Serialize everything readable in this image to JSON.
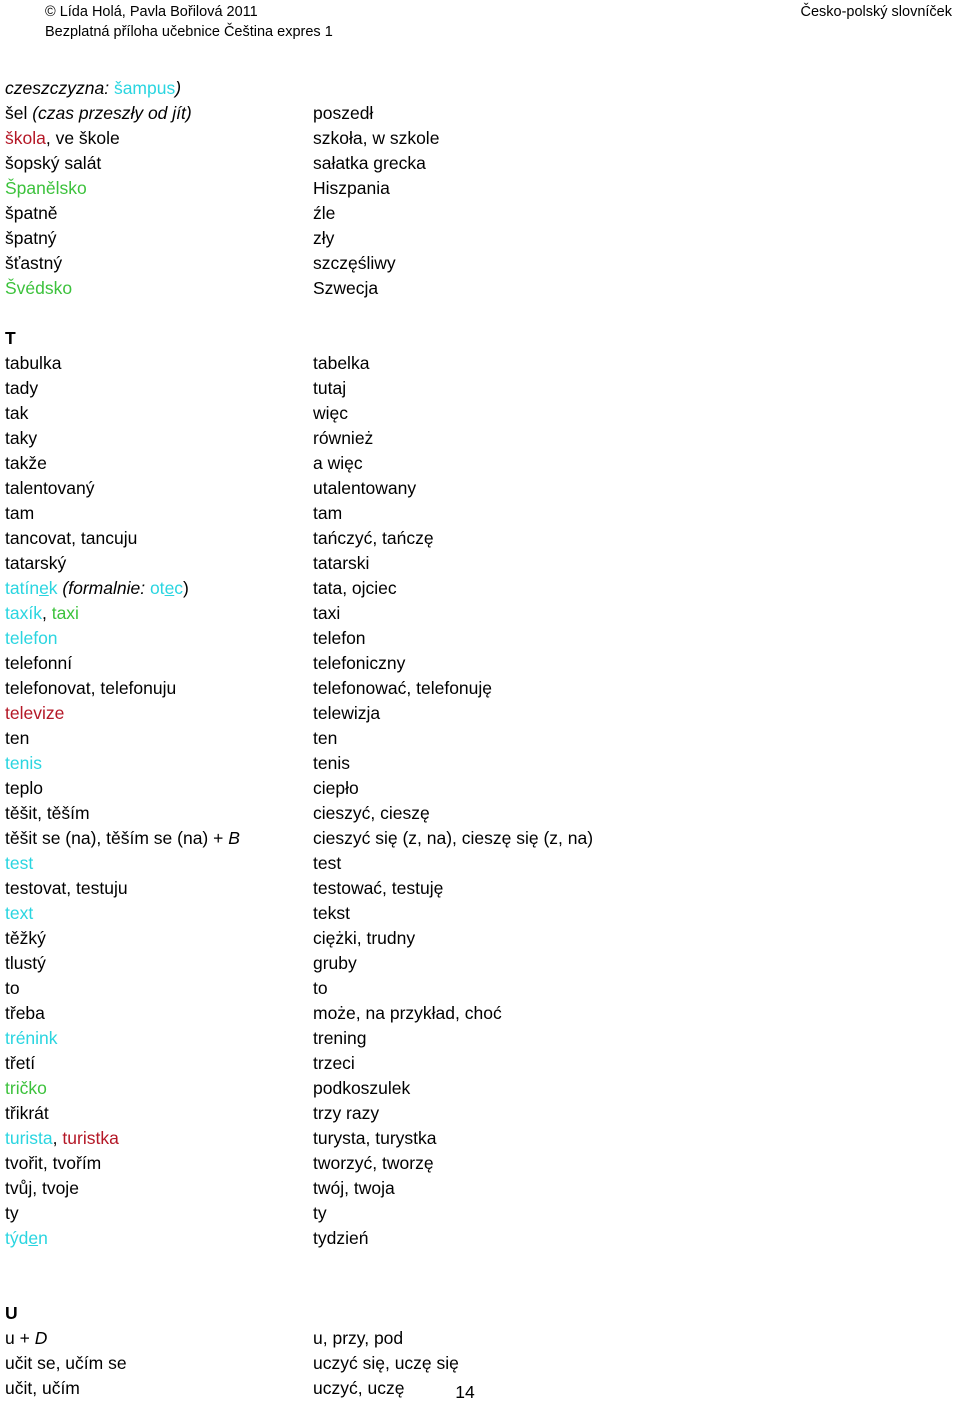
{
  "header": {
    "copyright": "© Lída Holá, Pavla Bořilová 2011",
    "subtitle": "Bezplatná příloha učebnice Čeština expres 1",
    "title": "Česko-polský slovníček"
  },
  "colors": {
    "cyan": "#2ad5e0",
    "green": "#3cc23c",
    "red": "#b41726",
    "black": "#000000"
  },
  "page_number": "14",
  "entries": [
    {
      "type": "entry",
      "cz": "czeszczyzna: šampus)",
      "pl": ""
    },
    {
      "type": "entry",
      "cz": "šel (czas przeszły od  jít)",
      "pl": "poszedł"
    },
    {
      "type": "entry",
      "cz": "škola, ve škole",
      "pl": "szkoła, w szkole"
    },
    {
      "type": "entry",
      "cz": "šopský salát",
      "pl": "sałatka grecka"
    },
    {
      "type": "entry",
      "cz": "Španělsko",
      "pl": "Hiszpania"
    },
    {
      "type": "entry",
      "cz": "špatně",
      "pl": "źle"
    },
    {
      "type": "entry",
      "cz": "špatný",
      "pl": "zły"
    },
    {
      "type": "entry",
      "cz": "šťastný",
      "pl": "szczęśliwy"
    },
    {
      "type": "entry",
      "cz": "Švédsko",
      "pl": "Szwecja"
    },
    {
      "type": "gap"
    },
    {
      "type": "letter",
      "cz": "T",
      "pl": ""
    },
    {
      "type": "entry",
      "cz": "tabulka",
      "pl": "tabelka"
    },
    {
      "type": "entry",
      "cz": "tady",
      "pl": "tutaj"
    },
    {
      "type": "entry",
      "cz": "tak",
      "pl": "więc"
    },
    {
      "type": "entry",
      "cz": "taky",
      "pl": "również"
    },
    {
      "type": "entry",
      "cz": "takže",
      "pl": "a więc"
    },
    {
      "type": "entry",
      "cz": "talentovaný",
      "pl": "utalentowany"
    },
    {
      "type": "entry",
      "cz": "tam",
      "pl": "tam"
    },
    {
      "type": "entry",
      "cz": "tancovat, tancuju",
      "pl": "tańczyć, tańczę"
    },
    {
      "type": "entry",
      "cz": "tatarský",
      "pl": "tatarski"
    },
    {
      "type": "entry",
      "cz": "tatínek (formalnie: otec)",
      "pl": "tata, ojciec"
    },
    {
      "type": "entry",
      "cz": "taxík, taxi",
      "pl": "taxi"
    },
    {
      "type": "entry",
      "cz": "telefon",
      "pl": "telefon"
    },
    {
      "type": "entry",
      "cz": "telefonní",
      "pl": "telefoniczny"
    },
    {
      "type": "entry",
      "cz": "telefonovat, telefonuju",
      "pl": "telefonować, telefonuję"
    },
    {
      "type": "entry",
      "cz": "televize",
      "pl": "telewizja"
    },
    {
      "type": "entry",
      "cz": "ten",
      "pl": "ten"
    },
    {
      "type": "entry",
      "cz": "tenis",
      "pl": "tenis"
    },
    {
      "type": "entry",
      "cz": "teplo",
      "pl": "ciepło"
    },
    {
      "type": "entry",
      "cz": "těšit, těším",
      "pl": "cieszyć, cieszę"
    },
    {
      "type": "entry",
      "cz": "těšit se (na), těším se (na) + B",
      "pl": "cieszyć się (z, na), cieszę się (z, na)"
    },
    {
      "type": "entry",
      "cz": "test",
      "pl": "test"
    },
    {
      "type": "entry",
      "cz": "testovat, testuju",
      "pl": "testować, testuję"
    },
    {
      "type": "entry",
      "cz": "text",
      "pl": "tekst"
    },
    {
      "type": "entry",
      "cz": "těžký",
      "pl": "ciężki, trudny"
    },
    {
      "type": "entry",
      "cz": "tlustý",
      "pl": "gruby"
    },
    {
      "type": "entry",
      "cz": "to",
      "pl": "to"
    },
    {
      "type": "entry",
      "cz": "třeba",
      "pl": "może, na przykład, choć"
    },
    {
      "type": "entry",
      "cz": "trénink",
      "pl": "trening"
    },
    {
      "type": "entry",
      "cz": "třetí",
      "pl": "trzeci"
    },
    {
      "type": "entry",
      "cz": "tričko",
      "pl": "podkoszulek"
    },
    {
      "type": "entry",
      "cz": "třikrát",
      "pl": "trzy razy"
    },
    {
      "type": "entry",
      "cz": "turista, turistka",
      "pl": "turysta, turystka"
    },
    {
      "type": "entry",
      "cz": "tvořit, tvořím",
      "pl": "tworzyć, tworzę"
    },
    {
      "type": "entry",
      "cz": "tvůj, tvoje",
      "pl": "twój, twoja"
    },
    {
      "type": "entry",
      "cz": "ty",
      "pl": "ty"
    },
    {
      "type": "entry",
      "cz": "týden",
      "pl": "tydzień"
    },
    {
      "type": "gap"
    },
    {
      "type": "gap"
    },
    {
      "type": "letter",
      "cz": "U",
      "pl": ""
    },
    {
      "type": "entry",
      "cz": "u + D",
      "pl": "u, przy, pod"
    },
    {
      "type": "entry",
      "cz": "učit se, učím se",
      "pl": "uczyć się, uczę się"
    },
    {
      "type": "entry",
      "cz": "učit, učím",
      "pl": "uczyć, uczę"
    }
  ],
  "cz_rich": {
    "0": [
      {
        "t": "czeszczyzna: ",
        "c": "black",
        "i": true
      },
      {
        "t": "šampus",
        "c": "cyan",
        "i": false
      },
      {
        "t": ")",
        "c": "black",
        "i": true
      }
    ],
    "1": [
      {
        "t": "šel ",
        "c": "black",
        "i": false
      },
      {
        "t": "(czas przeszły od  jít)",
        "c": "black",
        "i": true
      }
    ],
    "2": [
      {
        "t": "škola",
        "c": "red",
        "i": false
      },
      {
        "t": ", ve škole",
        "c": "black",
        "i": false
      }
    ],
    "3": [
      {
        "t": "šopský salát",
        "c": "black",
        "i": false
      }
    ],
    "4": [
      {
        "t": "Španělsko",
        "c": "green",
        "i": false
      }
    ],
    "5": [
      {
        "t": "špatně",
        "c": "black",
        "i": false
      }
    ],
    "6": [
      {
        "t": "špatný",
        "c": "black",
        "i": false
      }
    ],
    "7": [
      {
        "t": "šťastný",
        "c": "black",
        "i": false
      }
    ],
    "8": [
      {
        "t": "Švédsko",
        "c": "green",
        "i": false
      }
    ],
    "20": [
      {
        "t": "tatín",
        "c": "cyan",
        "i": false
      },
      {
        "t": "e",
        "c": "cyan",
        "i": false,
        "u": true
      },
      {
        "t": "k ",
        "c": "cyan",
        "i": false
      },
      {
        "t": "(formalnie: ",
        "c": "black",
        "i": true
      },
      {
        "t": "ot",
        "c": "cyan",
        "i": false
      },
      {
        "t": "e",
        "c": "cyan",
        "i": false,
        "u": true
      },
      {
        "t": "c",
        "c": "cyan",
        "i": false
      },
      {
        "t": ")",
        "c": "black",
        "i": false
      }
    ],
    "21": [
      {
        "t": "taxík",
        "c": "cyan",
        "i": false
      },
      {
        "t": ", ",
        "c": "black",
        "i": false
      },
      {
        "t": "taxi",
        "c": "green",
        "i": false
      }
    ],
    "22": [
      {
        "t": "telefon",
        "c": "cyan",
        "i": false
      }
    ],
    "25": [
      {
        "t": "televize",
        "c": "red",
        "i": false
      }
    ],
    "27": [
      {
        "t": "tenis",
        "c": "cyan",
        "i": false
      }
    ],
    "30": [
      {
        "t": "těšit se (na), těším se (na) + ",
        "c": "black",
        "i": false
      },
      {
        "t": "B",
        "c": "black",
        "i": true
      }
    ],
    "31": [
      {
        "t": "test",
        "c": "cyan",
        "i": false
      }
    ],
    "33": [
      {
        "t": "text",
        "c": "cyan",
        "i": false
      }
    ],
    "38": [
      {
        "t": "trénink",
        "c": "cyan",
        "i": false
      }
    ],
    "40": [
      {
        "t": "tričko",
        "c": "green",
        "i": false
      }
    ],
    "42": [
      {
        "t": "turista",
        "c": "cyan",
        "i": false
      },
      {
        "t": ", ",
        "c": "black",
        "i": false
      },
      {
        "t": "turistka",
        "c": "red",
        "i": false
      }
    ],
    "46": [
      {
        "t": "týd",
        "c": "cyan",
        "i": false
      },
      {
        "t": "e",
        "c": "cyan",
        "i": false,
        "u": true
      },
      {
        "t": "n",
        "c": "cyan",
        "i": false
      }
    ],
    "50": [
      {
        "t": "u + ",
        "c": "black",
        "i": false
      },
      {
        "t": "D",
        "c": "black",
        "i": true
      }
    ]
  }
}
